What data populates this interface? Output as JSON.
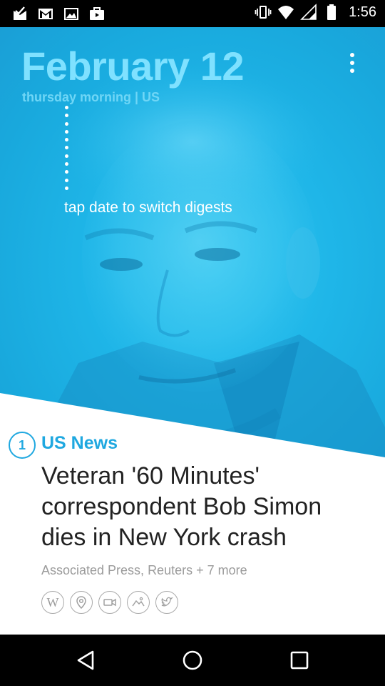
{
  "status_bar": {
    "time": "1:56",
    "left_icons": [
      "mail-check-icon",
      "gmail-icon",
      "image-icon",
      "store-icon"
    ],
    "right_icons": [
      "vibrate-icon",
      "wifi-icon",
      "signal-icon",
      "battery-icon"
    ]
  },
  "digest": {
    "date": "February 12",
    "subtitle": "thursday morning | US",
    "hint": "tap date to switch digests",
    "menu_icon": "overflow-menu-icon",
    "accent_color": "#1fa8e0"
  },
  "story": {
    "number": "1",
    "category": "US News",
    "headline": "Veteran '60 Minutes' correspondent Bob Simon dies in New York crash",
    "sources": "Associated Press, Reuters + 7 more",
    "actions": [
      "wikipedia-icon",
      "location-icon",
      "video-icon",
      "image-icon",
      "twitter-icon"
    ]
  },
  "nav_bar": {
    "buttons": [
      "back-icon",
      "home-icon",
      "recents-icon"
    ]
  }
}
